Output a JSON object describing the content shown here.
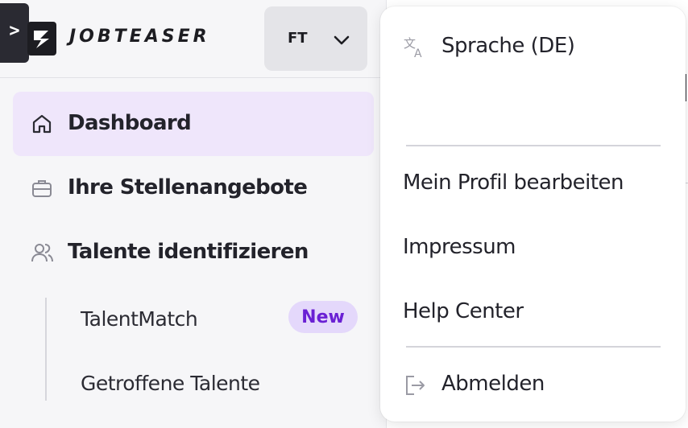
{
  "header": {
    "collapse_glyph": ">",
    "logo_text": "JOBTEASER",
    "account_initials": "FT"
  },
  "sidebar": {
    "items": [
      {
        "label": "Dashboard",
        "icon": "home-icon",
        "active": true
      },
      {
        "label": "Ihre Stellenangebote",
        "icon": "briefcase-icon"
      },
      {
        "label": "Talente identifizieren",
        "icon": "users-icon"
      }
    ],
    "subitems": [
      {
        "label": "TalentMatch",
        "badge": "New"
      },
      {
        "label": "Getroffene Talente"
      }
    ]
  },
  "menu": {
    "language": "Sprache (DE)",
    "edit_profile": "Mein Profil bearbeiten",
    "imprint": "Impressum",
    "help_center": "Help Center",
    "logout": "Abmelden"
  },
  "colors": {
    "accent": "#6a20d4",
    "active_bg": "#efe6fb",
    "badge_bg": "#e4d8fb",
    "sidebar_bg": "#f6f6f8"
  }
}
